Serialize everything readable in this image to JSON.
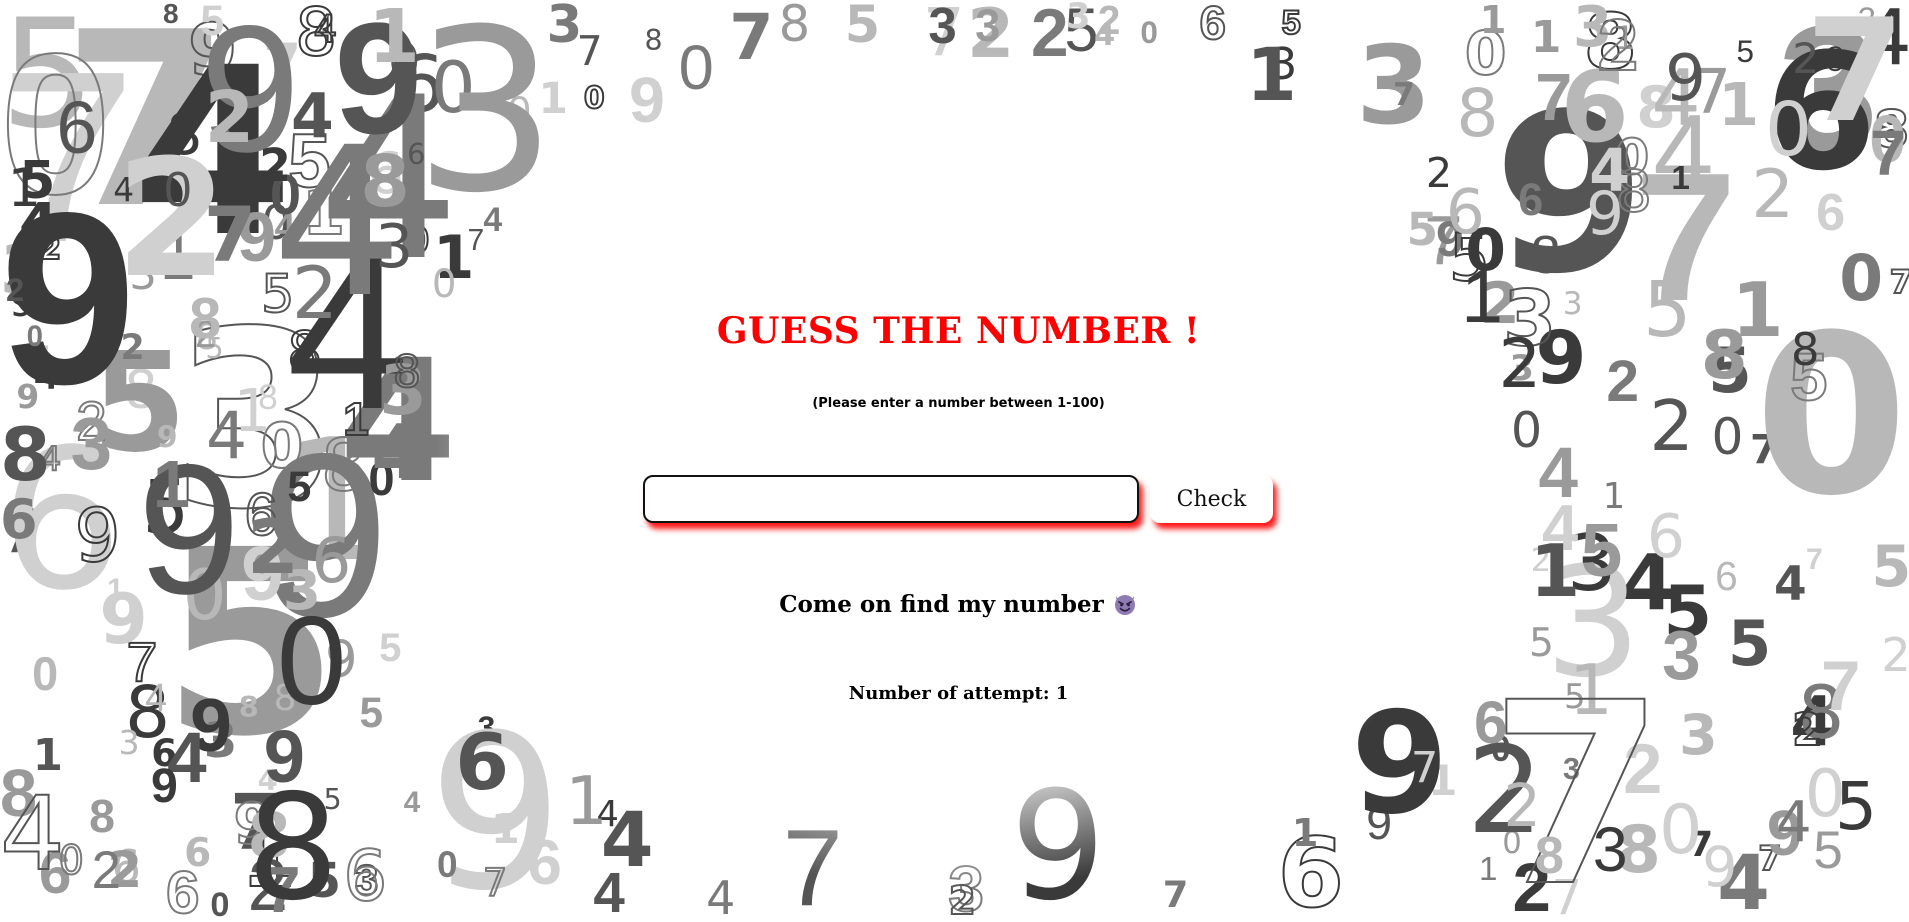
{
  "title": "GUESS THE NUMBER !",
  "subtitle": "(Please enter a number between 1-100)",
  "guess_input": {
    "value": "",
    "placeholder": ""
  },
  "check_button_label": "Check",
  "message": {
    "text": "Come on find my number",
    "icon": "smiling-devil-icon"
  },
  "attempts": {
    "label": "Number of attempt:",
    "count": "1",
    "text": "Number of attempt: 1"
  },
  "colors": {
    "title": "#ff0000",
    "button_shadow": "#ff0000",
    "background_digits": [
      "#3a3a3a",
      "#555555",
      "#7a7a7a",
      "#9a9a9a",
      "#b8b8b8",
      "#d0d0d0"
    ]
  },
  "background": {
    "pattern": "scattered-digits",
    "digits": "0123456789"
  }
}
